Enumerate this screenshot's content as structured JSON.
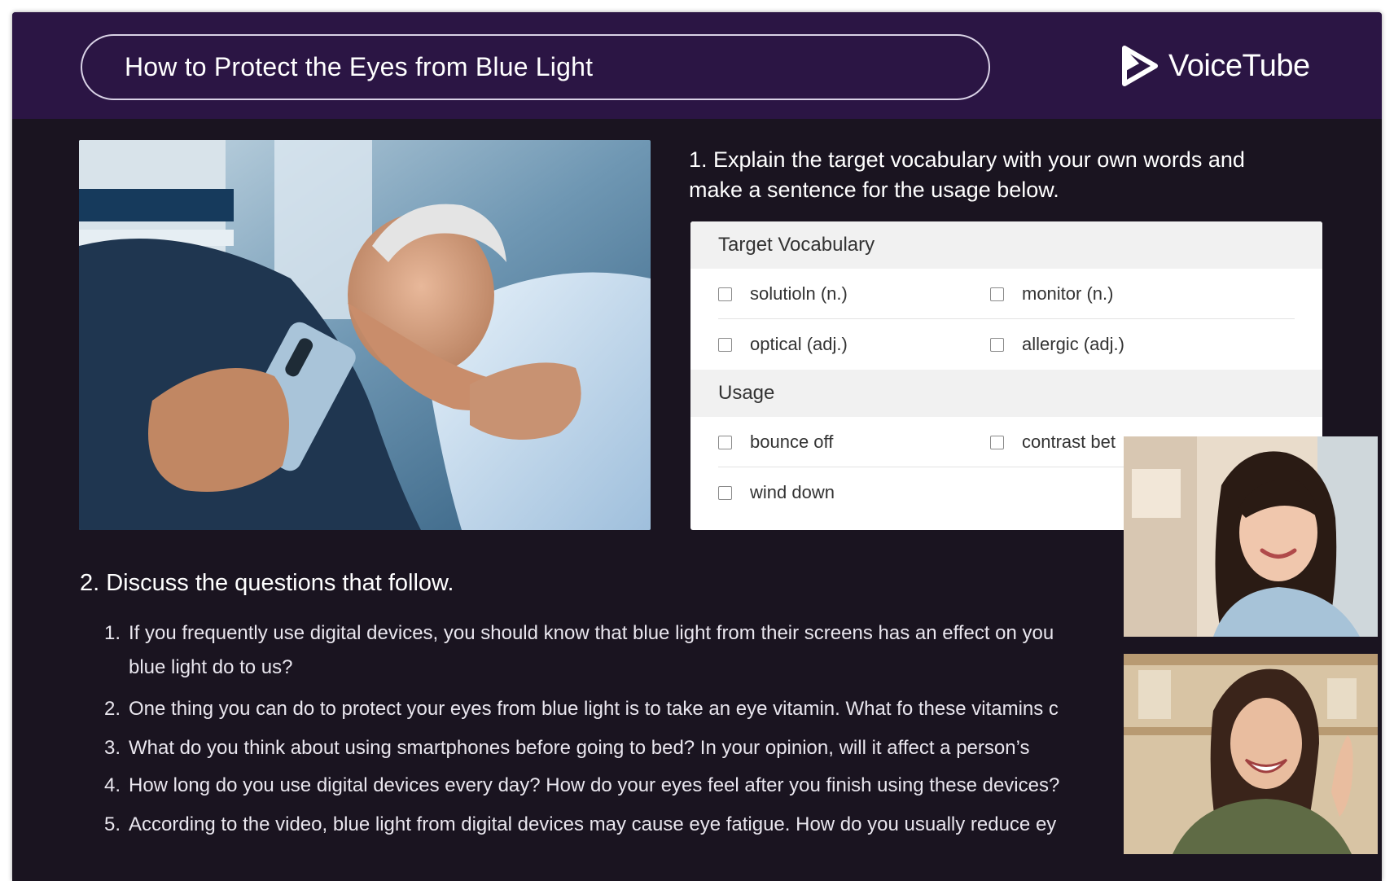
{
  "header": {
    "title": "How to Protect the Eyes from Blue Light",
    "brand": "VoiceTube"
  },
  "section1": {
    "prompt_line1": "1. Explain the target vocabulary with your own words and",
    "prompt_line2": "make a sentence for the usage below.",
    "vocab_header": "Target Vocabulary",
    "vocab": [
      "solutioln (n.)",
      "monitor (n.)",
      "optical (adj.)",
      "allergic (adj.)"
    ],
    "usage_header": "Usage",
    "usage": [
      "bounce off",
      "contrast bet",
      "wind down"
    ]
  },
  "section2": {
    "heading": "2. Discuss the questions that follow.",
    "questions": [
      {
        "num": "1.",
        "line1": "If you frequently use digital devices, you should know that blue light from their screens has an effect on you",
        "line2": "blue light do to us?"
      },
      {
        "num": "2.",
        "line1": "One thing you can do to protect your eyes from blue light is to take an eye vitamin. What fo these vitamins c"
      },
      {
        "num": "3.",
        "line1": " What do you think about using smartphones before going to bed? In your opinion, will it affect a person’s"
      },
      {
        "num": "4.",
        "line1": "How long do you use digital devices every day? How do your eyes feel after you finish using these devices?"
      },
      {
        "num": "5.",
        "line1": "According to the video, blue light from digital devices may cause eye fatigue. How do you usually reduce ey"
      }
    ]
  },
  "colors": {
    "header_bg": "#2b1544",
    "page_bg": "#1a1420",
    "card_bg": "#ffffff"
  }
}
